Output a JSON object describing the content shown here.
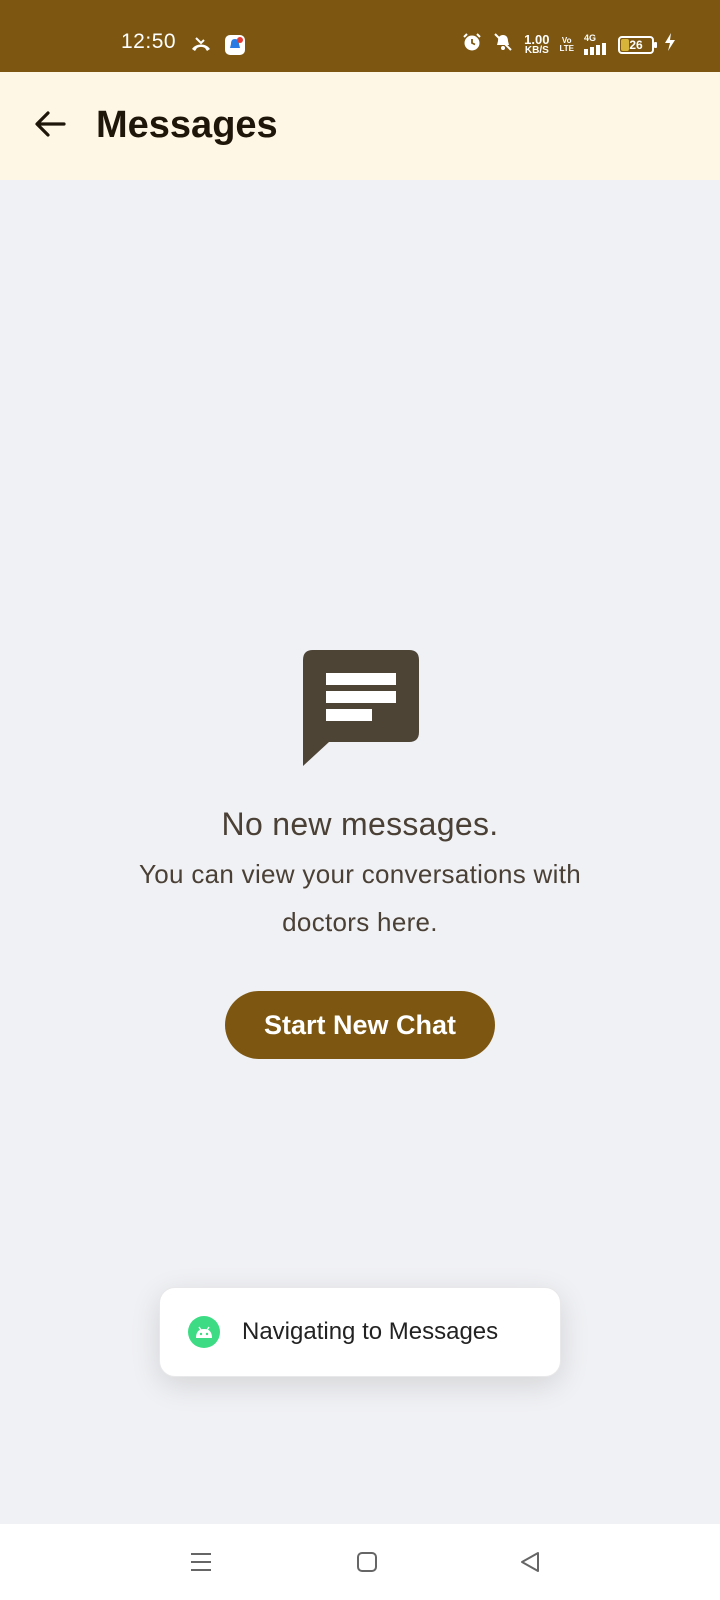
{
  "status_bar": {
    "time": "12:50",
    "net_speed_value": "1.00",
    "net_speed_unit": "KB/S",
    "volte_top": "Vo",
    "volte_bottom": "LTE",
    "network": "4G",
    "battery": "26",
    "icons": [
      "missed-call-icon",
      "notification-app-icon",
      "alarm-icon",
      "mute-icon",
      "signal-icon",
      "battery-icon",
      "charging-icon"
    ]
  },
  "app_bar": {
    "title": "Messages",
    "back_icon": "arrow-left-icon"
  },
  "empty_state": {
    "icon": "message-bubble-icon",
    "title": "No new messages.",
    "description": "You can view your conversations with doctors here.",
    "button_label": "Start New Chat"
  },
  "toast": {
    "icon": "android-icon",
    "text": "Navigating to Messages"
  },
  "nav_bar": {
    "icons": [
      "menu-icon",
      "home-icon",
      "back-icon"
    ]
  },
  "colors": {
    "primary": "#7d5711",
    "app_bar_bg": "#fff7e6",
    "page_bg": "#f0f1f4",
    "text_dark": "#4a4036",
    "icon_dark": "#4d4436"
  }
}
